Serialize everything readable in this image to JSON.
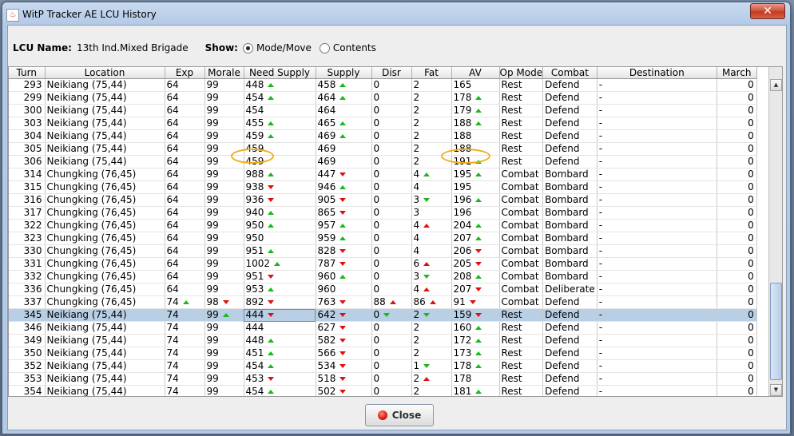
{
  "window": {
    "title": "WitP Tracker AE LCU History",
    "close_glyph": "✕"
  },
  "lcu": {
    "label": "LCU Name:",
    "name": "13th Ind.Mixed Brigade"
  },
  "show": {
    "label": "Show:",
    "options": [
      "Mode/Move",
      "Contents"
    ],
    "selected": "Mode/Move"
  },
  "columns": [
    "Turn",
    "Location",
    "Exp",
    "Morale",
    "Need Supply",
    "Supply",
    "Disr",
    "Fat",
    "AV",
    "Op Mode",
    "Combat",
    "Destination",
    "March"
  ],
  "rows": [
    {
      "turn": "293",
      "loc": "Neikiang (75,44)",
      "exp": "64",
      "morale": "99",
      "need": "448",
      "need_t": "up",
      "supply": "458",
      "supply_t": "up",
      "disr": "0",
      "fat": "2",
      "av": "165",
      "op": "Rest",
      "combat": "Defend",
      "dest": "-",
      "march": "0"
    },
    {
      "turn": "299",
      "loc": "Neikiang (75,44)",
      "exp": "64",
      "morale": "99",
      "need": "454",
      "need_t": "up",
      "supply": "464",
      "supply_t": "up",
      "disr": "0",
      "fat": "2",
      "av": "178",
      "av_t": "up",
      "op": "Rest",
      "combat": "Defend",
      "dest": "-",
      "march": "0"
    },
    {
      "turn": "300",
      "loc": "Neikiang (75,44)",
      "exp": "64",
      "morale": "99",
      "need": "454",
      "supply": "464",
      "disr": "0",
      "fat": "2",
      "av": "179",
      "av_t": "up",
      "op": "Rest",
      "combat": "Defend",
      "dest": "-",
      "march": "0"
    },
    {
      "turn": "303",
      "loc": "Neikiang (75,44)",
      "exp": "64",
      "morale": "99",
      "need": "455",
      "need_t": "up",
      "supply": "465",
      "supply_t": "up",
      "disr": "0",
      "fat": "2",
      "av": "188",
      "av_t": "up",
      "op": "Rest",
      "combat": "Defend",
      "dest": "-",
      "march": "0"
    },
    {
      "turn": "304",
      "loc": "Neikiang (75,44)",
      "exp": "64",
      "morale": "99",
      "need": "459",
      "need_t": "up",
      "supply": "469",
      "supply_t": "up",
      "disr": "0",
      "fat": "2",
      "av": "188",
      "op": "Rest",
      "combat": "Defend",
      "dest": "-",
      "march": "0"
    },
    {
      "turn": "305",
      "loc": "Neikiang (75,44)",
      "exp": "64",
      "morale": "99",
      "need": "459",
      "supply": "469",
      "disr": "0",
      "fat": "2",
      "av": "188",
      "op": "Rest",
      "combat": "Defend",
      "dest": "-",
      "march": "0"
    },
    {
      "turn": "306",
      "loc": "Neikiang (75,44)",
      "exp": "64",
      "morale": "99",
      "need": "459",
      "supply": "469",
      "disr": "0",
      "fat": "2",
      "av": "191",
      "av_t": "up",
      "op": "Rest",
      "combat": "Defend",
      "dest": "-",
      "march": "0"
    },
    {
      "turn": "314",
      "loc": "Chungking (76,45)",
      "exp": "64",
      "morale": "99",
      "need": "988",
      "need_t": "up",
      "supply": "447",
      "supply_t": "down",
      "disr": "0",
      "fat": "4",
      "fat_t": "up",
      "av": "195",
      "av_t": "up",
      "op": "Combat",
      "combat": "Bombard",
      "dest": "-",
      "march": "0"
    },
    {
      "turn": "315",
      "loc": "Chungking (76,45)",
      "exp": "64",
      "morale": "99",
      "need": "938",
      "need_t": "down",
      "supply": "946",
      "supply_t": "up",
      "disr": "0",
      "fat": "4",
      "av": "195",
      "op": "Combat",
      "combat": "Bombard",
      "dest": "-",
      "march": "0"
    },
    {
      "turn": "316",
      "loc": "Chungking (76,45)",
      "exp": "64",
      "morale": "99",
      "need": "936",
      "need_t": "down",
      "supply": "905",
      "supply_t": "down",
      "disr": "0",
      "fat": "3",
      "fat_t": "downg",
      "av": "196",
      "av_t": "up",
      "op": "Combat",
      "combat": "Bombard",
      "dest": "-",
      "march": "0"
    },
    {
      "turn": "317",
      "loc": "Chungking (76,45)",
      "exp": "64",
      "morale": "99",
      "need": "940",
      "need_t": "up",
      "supply": "865",
      "supply_t": "down",
      "disr": "0",
      "fat": "3",
      "av": "196",
      "op": "Combat",
      "combat": "Bombard",
      "dest": "-",
      "march": "0"
    },
    {
      "turn": "322",
      "loc": "Chungking (76,45)",
      "exp": "64",
      "morale": "99",
      "need": "950",
      "need_t": "up",
      "supply": "957",
      "supply_t": "up",
      "disr": "0",
      "fat": "4",
      "fat_t": "upr",
      "av": "204",
      "av_t": "up",
      "op": "Combat",
      "combat": "Bombard",
      "dest": "-",
      "march": "0"
    },
    {
      "turn": "323",
      "loc": "Chungking (76,45)",
      "exp": "64",
      "morale": "99",
      "need": "950",
      "supply": "959",
      "supply_t": "up",
      "disr": "0",
      "fat": "4",
      "av": "207",
      "av_t": "up",
      "op": "Combat",
      "combat": "Bombard",
      "dest": "-",
      "march": "0"
    },
    {
      "turn": "330",
      "loc": "Chungking (76,45)",
      "exp": "64",
      "morale": "99",
      "need": "951",
      "need_t": "up",
      "supply": "828",
      "supply_t": "down",
      "disr": "0",
      "fat": "4",
      "av": "206",
      "av_t": "down",
      "op": "Combat",
      "combat": "Bombard",
      "dest": "-",
      "march": "0"
    },
    {
      "turn": "331",
      "loc": "Chungking (76,45)",
      "exp": "64",
      "morale": "99",
      "need": "1002",
      "need_t": "up",
      "supply": "787",
      "supply_t": "down",
      "disr": "0",
      "fat": "6",
      "fat_t": "upr",
      "av": "205",
      "av_t": "down",
      "op": "Combat",
      "combat": "Bombard",
      "dest": "-",
      "march": "0"
    },
    {
      "turn": "332",
      "loc": "Chungking (76,45)",
      "exp": "64",
      "morale": "99",
      "need": "951",
      "need_t": "down",
      "supply": "960",
      "supply_t": "up",
      "disr": "0",
      "fat": "3",
      "fat_t": "downg",
      "av": "208",
      "av_t": "up",
      "op": "Combat",
      "combat": "Bombard",
      "dest": "-",
      "march": "0"
    },
    {
      "turn": "336",
      "loc": "Chungking (76,45)",
      "exp": "64",
      "morale": "99",
      "need": "953",
      "need_t": "up",
      "supply": "960",
      "disr": "0",
      "fat": "4",
      "fat_t": "upr",
      "av": "207",
      "av_t": "down",
      "op": "Combat",
      "combat": "Deliberate",
      "dest": "-",
      "march": "0"
    },
    {
      "turn": "337",
      "loc": "Chungking (76,45)",
      "exp": "74",
      "exp_t": "up",
      "morale": "98",
      "morale_t": "down",
      "need": "892",
      "need_t": "down",
      "supply": "763",
      "supply_t": "down",
      "disr": "88",
      "disr_t": "upr",
      "fat": "86",
      "fat_t": "upr",
      "av": "91",
      "av_t": "down",
      "op": "Combat",
      "combat": "Defend",
      "dest": "-",
      "march": "0"
    },
    {
      "turn": "345",
      "loc": "Neikiang (75,44)",
      "exp": "74",
      "morale": "99",
      "morale_t": "up",
      "need": "444",
      "need_t": "down",
      "supply": "642",
      "supply_t": "down",
      "disr": "0",
      "disr_t": "downg",
      "fat": "2",
      "fat_t": "downg",
      "av": "159",
      "av_t": "down",
      "op": "Rest",
      "combat": "Defend",
      "dest": "-",
      "march": "0",
      "selected": true
    },
    {
      "turn": "346",
      "loc": "Neikiang (75,44)",
      "exp": "74",
      "morale": "99",
      "need": "444",
      "supply": "627",
      "supply_t": "down",
      "disr": "0",
      "fat": "2",
      "av": "160",
      "av_t": "up",
      "op": "Rest",
      "combat": "Defend",
      "dest": "-",
      "march": "0"
    },
    {
      "turn": "349",
      "loc": "Neikiang (75,44)",
      "exp": "74",
      "morale": "99",
      "need": "448",
      "need_t": "up",
      "supply": "582",
      "supply_t": "down",
      "disr": "0",
      "fat": "2",
      "av": "172",
      "av_t": "up",
      "op": "Rest",
      "combat": "Defend",
      "dest": "-",
      "march": "0"
    },
    {
      "turn": "350",
      "loc": "Neikiang (75,44)",
      "exp": "74",
      "morale": "99",
      "need": "451",
      "need_t": "up",
      "supply": "566",
      "supply_t": "down",
      "disr": "0",
      "fat": "2",
      "av": "173",
      "av_t": "up",
      "op": "Rest",
      "combat": "Defend",
      "dest": "-",
      "march": "0"
    },
    {
      "turn": "352",
      "loc": "Neikiang (75,44)",
      "exp": "74",
      "morale": "99",
      "need": "454",
      "need_t": "up",
      "supply": "534",
      "supply_t": "down",
      "disr": "0",
      "fat": "1",
      "fat_t": "downg",
      "av": "178",
      "av_t": "up",
      "op": "Rest",
      "combat": "Defend",
      "dest": "-",
      "march": "0"
    },
    {
      "turn": "353",
      "loc": "Neikiang (75,44)",
      "exp": "74",
      "morale": "99",
      "need": "453",
      "need_t": "down",
      "supply": "518",
      "supply_t": "down",
      "disr": "0",
      "fat": "2",
      "fat_t": "upr",
      "av": "178",
      "op": "Rest",
      "combat": "Defend",
      "dest": "-",
      "march": "0"
    },
    {
      "turn": "354",
      "loc": "Neikiang (75,44)",
      "exp": "74",
      "morale": "99",
      "need": "454",
      "need_t": "up",
      "supply": "502",
      "supply_t": "down",
      "disr": "0",
      "fat": "2",
      "av": "181",
      "av_t": "up",
      "op": "Rest",
      "combat": "Defend",
      "dest": "-",
      "march": "0"
    }
  ],
  "footer": {
    "close_label": "Close"
  },
  "colors": {
    "up": "#19b81c",
    "down": "#e01010",
    "selection": "#b8cfe5",
    "highlight": "#f0ad1a"
  }
}
